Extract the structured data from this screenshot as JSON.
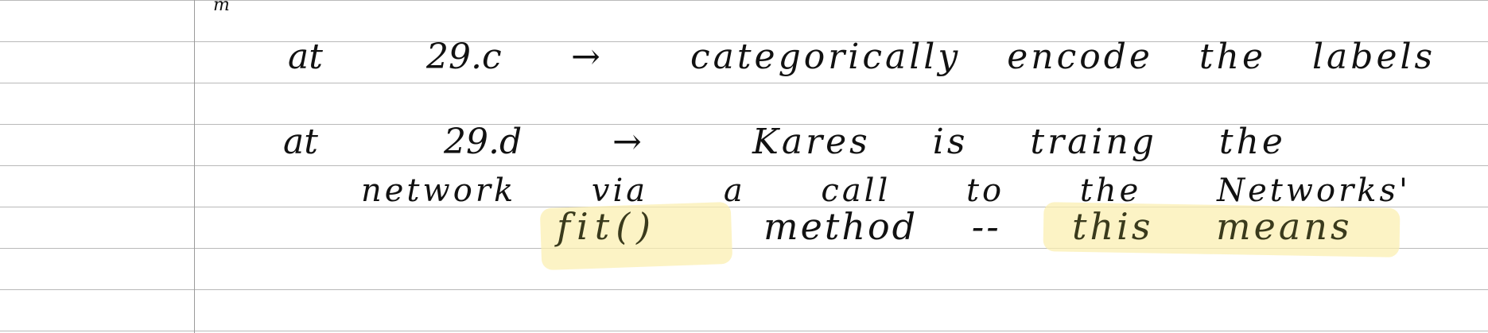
{
  "notes": {
    "stub": "m",
    "line1": {
      "at": "at",
      "ref": "29.c",
      "arrow": "→",
      "text": "categorically encode the labels"
    },
    "line2": {
      "at": "at",
      "ref": "29.d",
      "arrow": "→",
      "text": "Kares is traing the"
    },
    "line3": {
      "text": "network via a call to the Networks'"
    },
    "line4": {
      "fit": "fit()",
      "method": "method --",
      "this_means": "this means"
    }
  },
  "colors": {
    "ruling": "#b9b9b9",
    "margin": "#9a9a9a",
    "highlight": "#fbefb2",
    "ink": "#111111"
  }
}
